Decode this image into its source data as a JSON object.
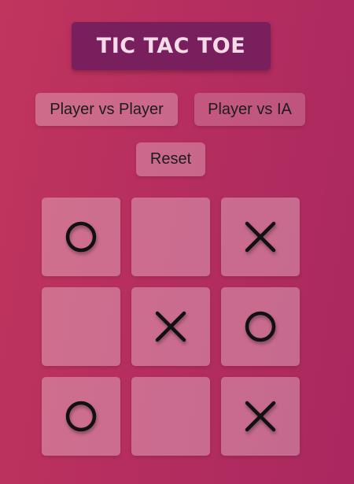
{
  "title": "TIC TAC TOE",
  "buttons": {
    "pvp": "Player vs Player",
    "pvia": "Player vs IA",
    "reset": "Reset"
  },
  "board": [
    [
      "O",
      "",
      "X"
    ],
    [
      "",
      "X",
      "O"
    ],
    [
      "O",
      "",
      "X"
    ]
  ],
  "colors": {
    "background_start": "#c0355e",
    "background_end": "#a9285f",
    "title_bg": "#7a1f5e",
    "title_text": "#f4dbe8",
    "mark": "#111111"
  }
}
